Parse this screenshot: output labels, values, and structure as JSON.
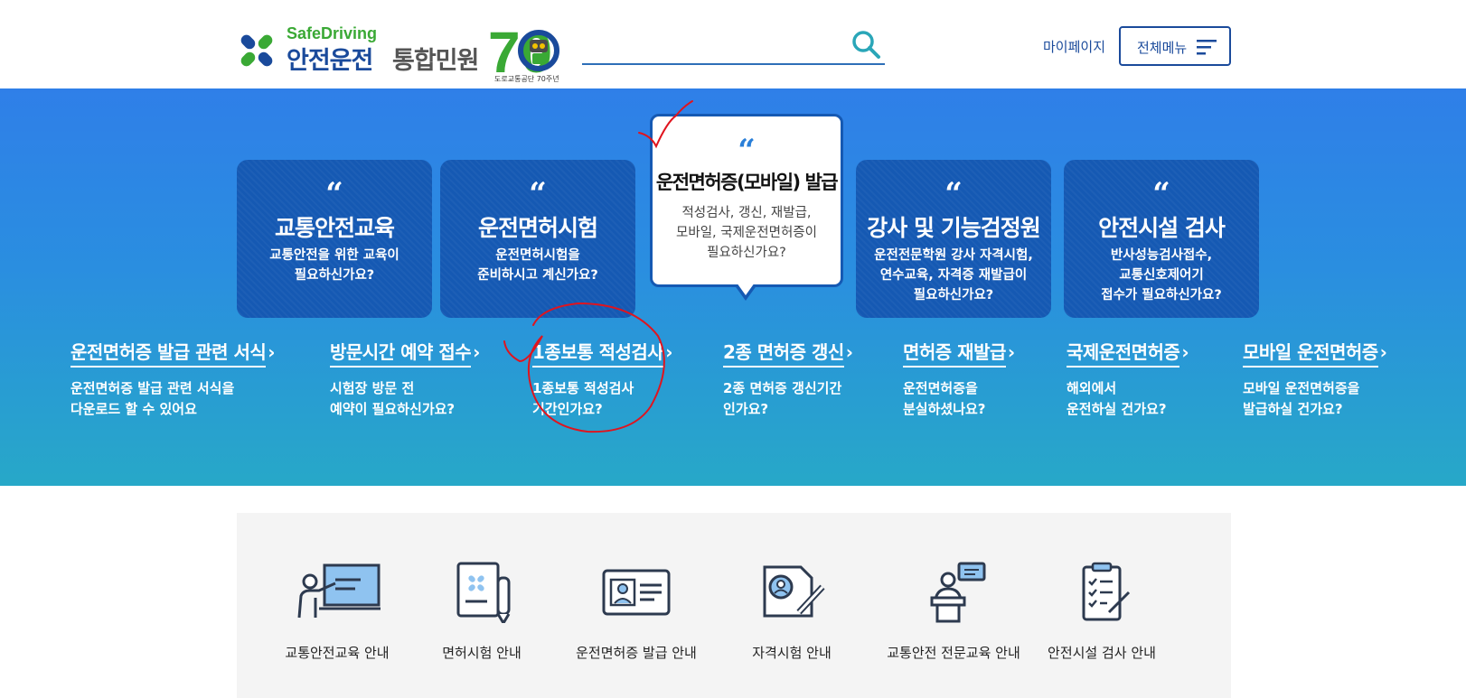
{
  "header": {
    "logo_sub": "SafeDriving",
    "logo_main": "안전운전",
    "logo_main2": "통합민원",
    "logo_70": "70",
    "logo_70_caption": "도로교통공단 70주년",
    "search_placeholder": "",
    "mypage_label": "마이페이지",
    "allmenu_label": "전체메뉴"
  },
  "cards": [
    {
      "quote": "“",
      "title": "교통안전교육",
      "desc_1": "교통안전을 위한 교육이",
      "desc_2": "필요하신가요?"
    },
    {
      "quote": "“",
      "title": "운전면허시험",
      "desc_1": "운전면허시험을",
      "desc_2": "준비하시고 계신가요?"
    },
    {
      "quote": "“",
      "title": "운전면허증(모바일) 발급",
      "desc_1": "적성검사, 갱신, 재발급,",
      "desc_2": "모바일, 국제운전면허증이",
      "desc_3": "필요하신가요?"
    },
    {
      "quote": "“",
      "title": "강사 및 기능검정원",
      "desc_1": "운전전문학원 강사 자격시험,",
      "desc_2": "연수교육, 자격증 재발급이",
      "desc_3": "필요하신가요?"
    },
    {
      "quote": "“",
      "title": "안전시설 검사",
      "desc_1": "반사성능검사접수,",
      "desc_2": "교통신호제어기",
      "desc_3": "접수가 필요하신가요?"
    }
  ],
  "links": [
    {
      "title": "운전면허증 발급 관련 서식",
      "arrow": "›",
      "desc_1": "운전면허증 발급 관련 서식을",
      "desc_2": "다운로드 할 수 있어요"
    },
    {
      "title": "방문시간 예약 접수",
      "arrow": "›",
      "desc_1": "시험장 방문 전",
      "desc_2": "예약이 필요하신가요?"
    },
    {
      "title": "1종보통 적성검사",
      "arrow": "›",
      "desc_1": "1종보통 적성검사",
      "desc_2": "기간인가요?"
    },
    {
      "title": "2종 면허증 갱신",
      "arrow": "›",
      "desc_1": "2종 면허증 갱신기간",
      "desc_2": "인가요?"
    },
    {
      "title": "면허증 재발급",
      "arrow": "›",
      "desc_1": "운전면허증을",
      "desc_2": "분실하셨나요?"
    },
    {
      "title": "국제운전면허증",
      "arrow": "›",
      "desc_1": "해외에서",
      "desc_2": "운전하실 건가요?"
    },
    {
      "title": "모바일 운전면허증",
      "arrow": "›",
      "desc_1": "모바일 운전면허증을",
      "desc_2": "발급하실 건가요?"
    }
  ],
  "services": [
    {
      "label": "교통안전교육 안내",
      "icon": "lecture-board-icon"
    },
    {
      "label": "면허시험 안내",
      "icon": "exam-document-icon"
    },
    {
      "label": "운전면허증 발급 안내",
      "icon": "license-card-icon"
    },
    {
      "label": "자격시험 안내",
      "icon": "qualification-test-icon"
    },
    {
      "label": "교통안전 전문교육 안내",
      "icon": "podium-speaker-icon"
    },
    {
      "label": "안전시설 검사 안내",
      "icon": "checklist-clipboard-icon"
    }
  ],
  "colors": {
    "brand_blue": "#1a4a9b",
    "brand_green": "#3aa935",
    "card_bg": "#1559b3",
    "hero_top": "#2f7fe8",
    "hero_bottom": "#27a8c8",
    "annotation_red": "#e0141e"
  }
}
